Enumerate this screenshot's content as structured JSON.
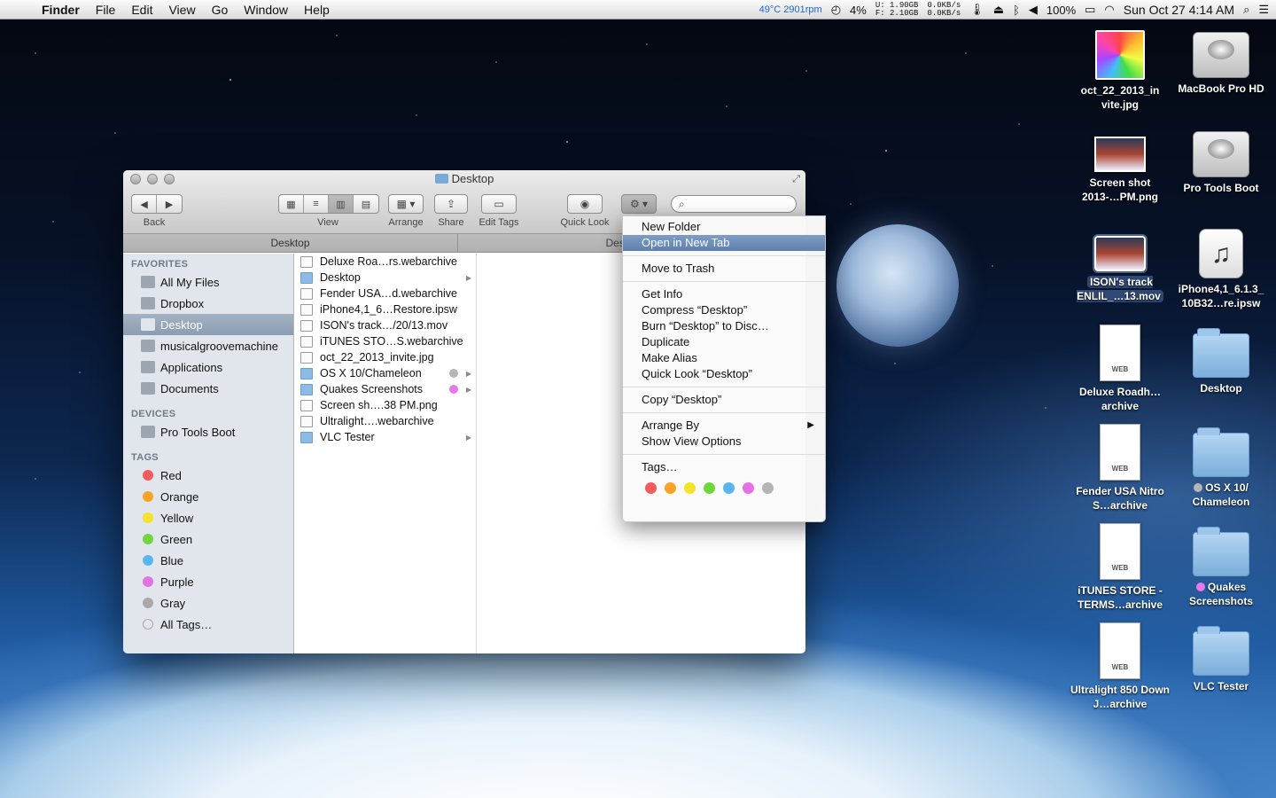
{
  "menubar": {
    "app_name": "Finder",
    "menus": [
      "File",
      "Edit",
      "View",
      "Go",
      "Window",
      "Help"
    ],
    "temp": "49°C 2901rpm",
    "cpu": "4%",
    "mem_u": "1.90GB",
    "mem_f": "2.10GB",
    "net_up": "0.0KB/s",
    "net_down": "0.0KB/s",
    "battery": "100%",
    "clock": "Sun Oct 27  4:14 AM"
  },
  "window": {
    "title": "Desktop",
    "toolbar": {
      "back": "Back",
      "view": "View",
      "arrange": "Arrange",
      "share": "Share",
      "edit_tags": "Edit Tags",
      "quick_look": "Quick Look"
    },
    "tabs": [
      "Desktop",
      "Desktop"
    ],
    "sidebar": {
      "favorites_header": "FAVORITES",
      "favorites": [
        "All My Files",
        "Dropbox",
        "Desktop",
        "musicalgroovemachine",
        "Applications",
        "Documents"
      ],
      "devices_header": "DEVICES",
      "devices": [
        "Pro Tools Boot"
      ],
      "tags_header": "TAGS",
      "tags": [
        {
          "label": "Red",
          "color": "#f25c5c"
        },
        {
          "label": "Orange",
          "color": "#f7a326"
        },
        {
          "label": "Yellow",
          "color": "#f5e12a"
        },
        {
          "label": "Green",
          "color": "#6fd63b"
        },
        {
          "label": "Blue",
          "color": "#59b5f2"
        },
        {
          "label": "Purple",
          "color": "#e272e6"
        },
        {
          "label": "Gray",
          "color": "#a9a9a9"
        },
        {
          "label": "All Tags…",
          "color": "#d8d8d8"
        }
      ]
    },
    "files": [
      {
        "name": "Deluxe Roa…rs.webarchive",
        "kind": "doc",
        "arrow": false,
        "tag": ""
      },
      {
        "name": "Desktop",
        "kind": "folder",
        "arrow": true,
        "tag": ""
      },
      {
        "name": "Fender USA…d.webarchive",
        "kind": "doc",
        "arrow": false,
        "tag": ""
      },
      {
        "name": "iPhone4,1_6…Restore.ipsw",
        "kind": "doc",
        "arrow": false,
        "tag": ""
      },
      {
        "name": "ISON's track…/20/13.mov",
        "kind": "doc",
        "arrow": false,
        "tag": ""
      },
      {
        "name": "iTUNES STO…S.webarchive",
        "kind": "doc",
        "arrow": false,
        "tag": ""
      },
      {
        "name": "oct_22_2013_invite.jpg",
        "kind": "doc",
        "arrow": false,
        "tag": ""
      },
      {
        "name": "OS X 10/Chameleon",
        "kind": "folder",
        "arrow": true,
        "tag": "#b5b5b5"
      },
      {
        "name": "Quakes Screenshots",
        "kind": "folder",
        "arrow": true,
        "tag": "#e57ae8"
      },
      {
        "name": "Screen sh….38 PM.png",
        "kind": "doc",
        "arrow": false,
        "tag": ""
      },
      {
        "name": "Ultralight….webarchive",
        "kind": "doc",
        "arrow": false,
        "tag": ""
      },
      {
        "name": "VLC Tester",
        "kind": "folder",
        "arrow": true,
        "tag": ""
      }
    ]
  },
  "context_menu": {
    "groups": [
      [
        "New Folder",
        "Open in New Tab"
      ],
      [
        "Move to Trash"
      ],
      [
        "Get Info",
        "Compress “Desktop”",
        "Burn “Desktop” to Disc…",
        "Duplicate",
        "Make Alias",
        "Quick Look “Desktop”"
      ],
      [
        "Copy “Desktop”"
      ],
      [
        "Arrange By",
        "Show View Options"
      ],
      [
        "Tags…"
      ]
    ],
    "highlighted": "Open in New Tab",
    "submenu_item": "Arrange By",
    "tag_colors": [
      "#f25c5c",
      "#f7a326",
      "#f5e12a",
      "#6fd63b",
      "#59b5f2",
      "#e272e6",
      "#b5b5b5"
    ]
  },
  "desktop_icons": [
    {
      "label": "oct_22_2013_in vite.jpg",
      "icon": "image-icon"
    },
    {
      "label": "MacBook Pro HD",
      "icon": "hard-drive-icon"
    },
    {
      "label": "Screen shot 2013-…PM.png",
      "icon": "screenshot-icon"
    },
    {
      "label": "Pro Tools Boot",
      "icon": "hard-drive-icon"
    },
    {
      "label": "ISON's track ENLIL_…13.mov",
      "icon": "movie-icon"
    },
    {
      "label": "iPhone4,1_6.1.3_ 10B32…re.ipsw",
      "icon": "ipsw-icon"
    },
    {
      "label": "Deluxe Roadh…archive",
      "icon": "webarchive-icon"
    },
    {
      "label": "Desktop",
      "icon": "folder-icon"
    },
    {
      "label": "Fender USA Nitro S…archive",
      "icon": "webarchive-icon"
    },
    {
      "label": "OS X 10/ Chameleon",
      "icon": "folder-icon"
    },
    {
      "label": "iTUNES STORE - TERMS…archive",
      "icon": "webarchive-icon"
    },
    {
      "label": "Quakes Screenshots",
      "icon": "folder-icon"
    },
    {
      "label": "Ultralight 850 Down J…archive",
      "icon": "webarchive-icon"
    },
    {
      "label": "VLC Tester",
      "icon": "folder-icon"
    }
  ],
  "web_badge": "WEB"
}
